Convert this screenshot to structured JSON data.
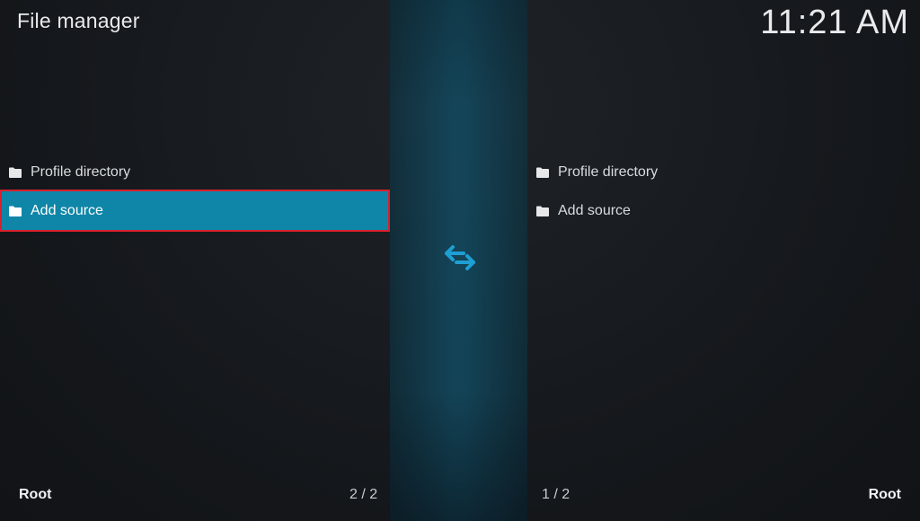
{
  "header": {
    "title": "File manager",
    "clock": "11:21 AM"
  },
  "left_panel": {
    "items": [
      {
        "label": "Profile directory",
        "icon": "folder-icon",
        "selected": false
      },
      {
        "label": "Add source",
        "icon": "folder-icon",
        "selected": true
      }
    ],
    "footer_label": "Root",
    "count": "2 / 2"
  },
  "right_panel": {
    "items": [
      {
        "label": "Profile directory",
        "icon": "folder-icon",
        "selected": false
      },
      {
        "label": "Add source",
        "icon": "folder-icon",
        "selected": false
      }
    ],
    "footer_label": "Root",
    "count": "1 / 2"
  },
  "center": {
    "icon": "swap-arrows-icon"
  },
  "colors": {
    "accent": "#0f86a8",
    "highlight_border": "#d8202c",
    "swap_icon": "#1e9fd4",
    "background": "#16191d"
  }
}
